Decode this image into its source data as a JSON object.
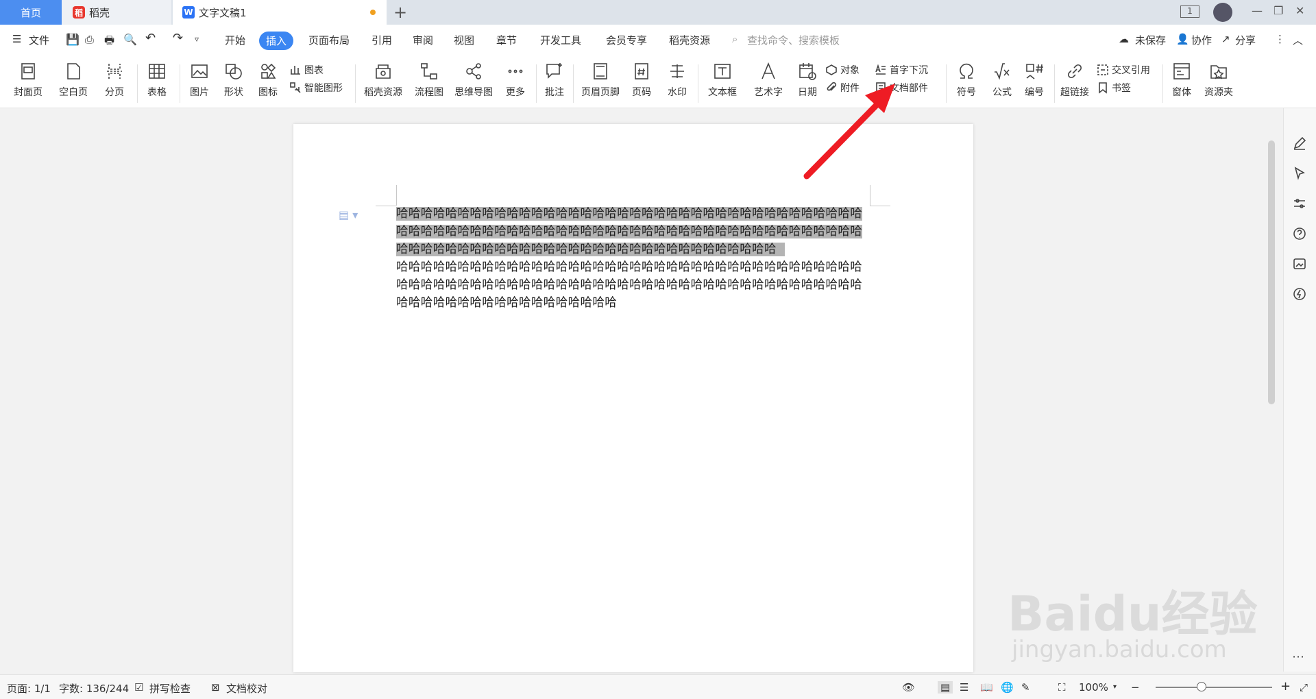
{
  "tabs": {
    "home": "首页",
    "daoke": "稻壳",
    "doc": "文字文稿1",
    "page_indicator": "1"
  },
  "menu": {
    "file": "文件",
    "items": [
      "开始",
      "插入",
      "页面布局",
      "引用",
      "审阅",
      "视图",
      "章节",
      "开发工具",
      "会员专享",
      "稻壳资源"
    ],
    "active": "插入",
    "search_placeholder": "查找命令、搜索模板",
    "unsaved": "未保存",
    "collab": "协作",
    "share": "分享"
  },
  "ribbon": {
    "cover": "封面页",
    "blank": "空白页",
    "pagebreak": "分页",
    "table": "表格",
    "picture": "图片",
    "shape": "形状",
    "icon": "图标",
    "chart": "图表",
    "smartart": "智能图形",
    "daoke_res": "稻壳资源",
    "flow": "流程图",
    "mindmap": "思维导图",
    "more": "更多",
    "comment": "批注",
    "headerfooter": "页眉页脚",
    "pagenum": "页码",
    "watermark": "水印",
    "textbox": "文本框",
    "wordart": "艺术字",
    "date": "日期",
    "object": "对象",
    "attach": "附件",
    "dropcap": "首字下沉",
    "docparts": "文档部件",
    "symbol": "符号",
    "formula": "公式",
    "numbering": "编号",
    "hyperlink": "超链接",
    "crossref": "交叉引用",
    "bookmark": "书签",
    "window": "窗体",
    "resource": "资源夹"
  },
  "document": {
    "selected_text": "哈哈哈哈哈哈哈哈哈哈哈哈哈哈哈哈哈哈哈哈哈哈哈哈哈哈哈哈哈哈哈哈哈哈哈哈哈哈哈哈哈哈哈哈哈哈哈哈哈哈哈哈哈哈哈哈哈哈哈哈哈哈哈哈哈哈哈哈哈哈哈哈哈哈哈哈哈哈哈哈哈哈哈哈哈哈哈哈哈哈哈哈哈哈哈哈哈哈哈哈哈哈哈哈哈哈哈",
    "plain_text": "哈哈哈哈哈哈哈哈哈哈哈哈哈哈哈哈哈哈哈哈哈哈哈哈哈哈哈哈哈哈哈哈哈哈哈哈哈哈哈哈哈哈哈哈哈哈哈哈哈哈哈哈哈哈哈哈哈哈哈哈哈哈哈哈哈哈哈哈哈哈哈哈哈哈哈哈哈哈哈哈哈哈哈哈哈哈哈哈哈哈哈哈哈哈"
  },
  "status": {
    "page": "页面: 1/1",
    "words": "字数: 136/244",
    "spell": "拼写检查",
    "proof": "文档校对",
    "zoom": "100%"
  },
  "watermark": {
    "brand": "Baidu经验",
    "url": "jingyan.baidu.com"
  },
  "colors": {
    "accent": "#3b86f2",
    "arrow": "#ee1c24",
    "selection": "#b4b4b4"
  }
}
